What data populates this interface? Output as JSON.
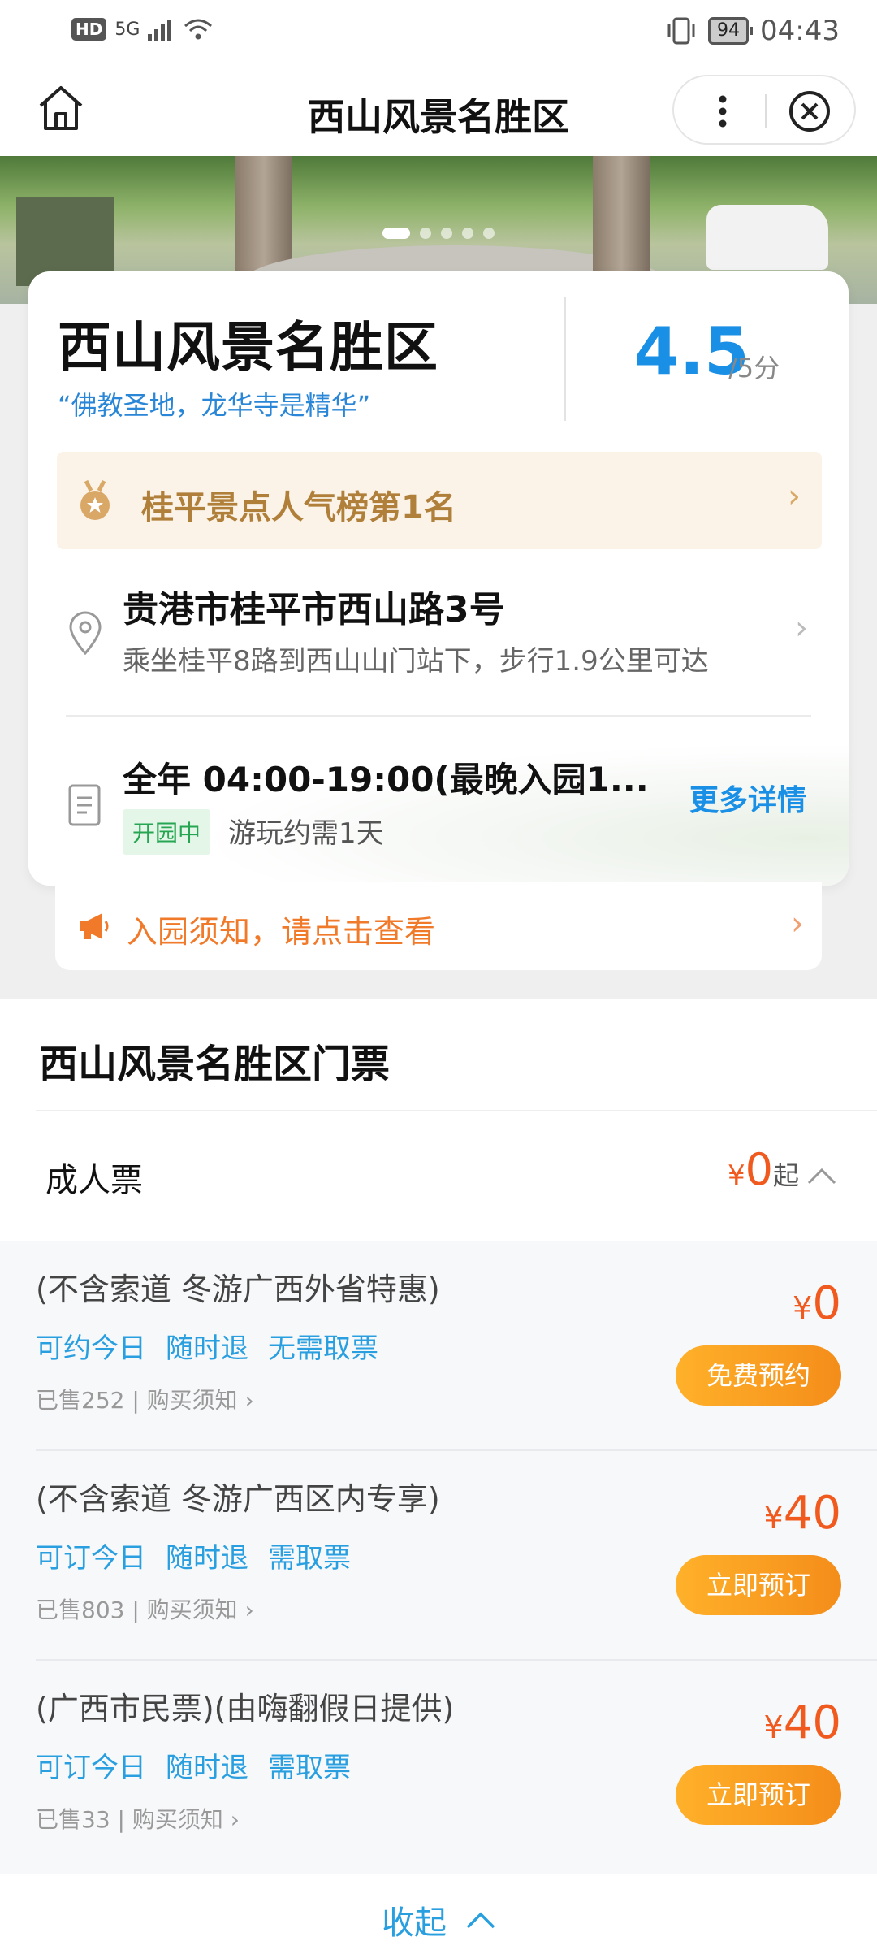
{
  "status_bar": {
    "hd": "HD",
    "network": "5G",
    "battery": "94",
    "time": "04:43"
  },
  "header": {
    "title": "西山风景名胜区",
    "icons": [
      "home-icon",
      "more-icon",
      "close-icon"
    ]
  },
  "banner": {
    "slide_count": 5,
    "active_index": 0
  },
  "scenic": {
    "name": "西山风景名胜区",
    "slogan": "“佛教圣地，龙华寺是精华”",
    "rating": "4.5",
    "rating_unit": "/5分",
    "rank": "桂平景点人气榜第1名",
    "address": "贵港市桂平市西山路3号",
    "directions": "乘坐桂平8路到西山山门站下，步行1.9公里可达",
    "hours": "全年 04:00-19:00(最晚入园1...",
    "status": "开园中",
    "play_time": "游玩约需1天",
    "more_detail": "更多详情",
    "notice": "入园须知，请点击查看"
  },
  "tickets": {
    "title": "西山风景名胜区门票",
    "category": "成人票",
    "category_price_symbol": "¥",
    "category_price": "0",
    "category_price_suffix": "起",
    "items": [
      {
        "name": "(不含索道 冬游广西外省特惠)",
        "tags": [
          "可约今日",
          "随时退",
          "无需取票"
        ],
        "sold": "已售252 | 购买须知",
        "price_symbol": "¥",
        "price": "0",
        "button": "免费预约"
      },
      {
        "name": "(不含索道 冬游广西区内专享)",
        "tags": [
          "可订今日",
          "随时退",
          "需取票"
        ],
        "sold": "已售803 | 购买须知",
        "price_symbol": "¥",
        "price": "40",
        "button": "立即预订"
      },
      {
        "name": "(广西市民票)(由嗨翻假日提供)",
        "tags": [
          "可订今日",
          "随时退",
          "需取票"
        ],
        "sold": "已售33 | 购买须知",
        "price_symbol": "¥",
        "price": "40",
        "button": "立即预订"
      }
    ],
    "collapse": "收起"
  },
  "colors": {
    "accent_blue": "#1a8fe6",
    "price_orange": "#f15a1f",
    "button_orange": "#f48d1a",
    "rank_gold": "#b07f3a",
    "open_green": "#26a552"
  }
}
